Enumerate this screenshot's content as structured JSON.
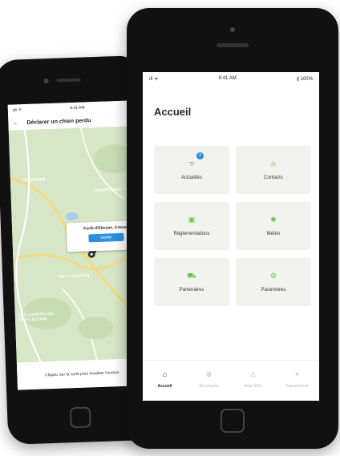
{
  "back_phone": {
    "status": {
      "signal": "ati ᯤ",
      "time": "9:41 AM"
    },
    "header": {
      "back_arrow": "←",
      "title": "Déclarer un chien perdu"
    },
    "map": {
      "labels": [
        "LESCURES",
        "CHARTONNE",
        "PUY CHABROL",
        "LES LANDES DE VEIGLECOUR"
      ],
      "popup_title": "Forêt d'Eheyan, Creuse",
      "popup_button": "Valider"
    },
    "footer_text": "Cliquez sur la carte pour localiser l'endroit"
  },
  "front_phone": {
    "status": {
      "signal": "ıll ᯤ",
      "time": "9:41 AM",
      "battery": "∦ 100%"
    },
    "page_title": "Accueil",
    "tiles": [
      {
        "label": "Actualités",
        "icon": "rss-icon",
        "glyph": "ᯤ",
        "badge": "2"
      },
      {
        "label": "Contacts",
        "icon": "person-icon",
        "glyph": "⍝"
      },
      {
        "label": "Réglementations",
        "icon": "clipboard-icon",
        "glyph": "▣"
      },
      {
        "label": "Météo",
        "icon": "weather-icon",
        "glyph": "✺"
      },
      {
        "label": "Partenaires",
        "icon": "cart-icon",
        "glyph": "⛟"
      },
      {
        "label": "Paramètres",
        "icon": "gear-icon",
        "glyph": "⚙"
      }
    ],
    "tabs": [
      {
        "label": "Accueil",
        "icon": "home-icon",
        "glyph": "⌂",
        "active": true
      },
      {
        "label": "Ma chasse",
        "icon": "target-icon",
        "glyph": "⊕"
      },
      {
        "label": "Aide SOS",
        "icon": "warning-icon",
        "glyph": "⚠"
      },
      {
        "label": "Signalement",
        "icon": "location-icon",
        "glyph": "⌖"
      }
    ],
    "accent_color": "#6ac04a",
    "badge_color": "#2a8fe0"
  }
}
